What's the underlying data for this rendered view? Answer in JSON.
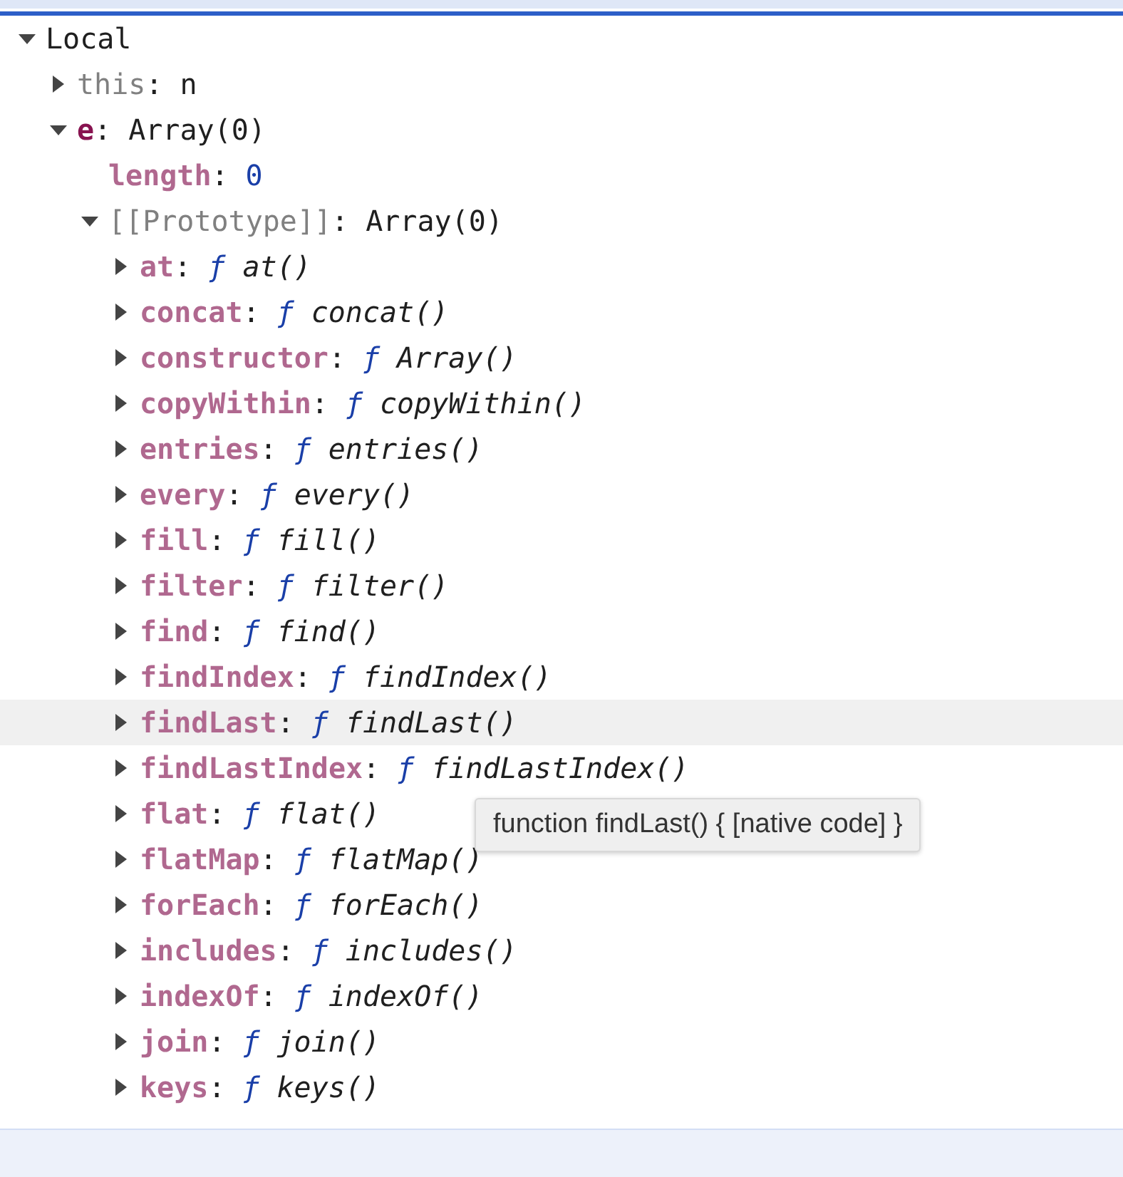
{
  "scope_tree": [
    {
      "name": {
        "text": "Local",
        "kind": "scope"
      },
      "kind": "expandable",
      "expanded": true,
      "selected": false,
      "children": [
        {
          "name": {
            "text": "this",
            "kind": "dim"
          },
          "separator": ":",
          "value": {
            "text": "n",
            "kind": "object"
          },
          "kind": "expandable",
          "expanded": false,
          "selected": false
        },
        {
          "name": {
            "text": "e",
            "kind": "variable"
          },
          "separator": ":",
          "value": {
            "text": "Array(0)",
            "kind": "object"
          },
          "kind": "expandable",
          "expanded": true,
          "selected": false,
          "children": [
            {
              "name": {
                "text": "length",
                "kind": "property"
              },
              "separator": ":",
              "value": {
                "text": "0",
                "kind": "number"
              },
              "kind": "leaf",
              "selected": false
            },
            {
              "name": {
                "text": "[[Prototype]]",
                "kind": "dim"
              },
              "separator": ":",
              "value": {
                "text": "Array(0)",
                "kind": "object"
              },
              "kind": "expandable",
              "expanded": true,
              "selected": false,
              "children": [
                {
                  "name": {
                    "text": "at",
                    "kind": "property"
                  },
                  "separator": ":",
                  "type_mark": "ƒ",
                  "value": {
                    "text": "at()",
                    "kind": "function"
                  },
                  "kind": "expandable",
                  "expanded": false,
                  "selected": false
                },
                {
                  "name": {
                    "text": "concat",
                    "kind": "property"
                  },
                  "separator": ":",
                  "type_mark": "ƒ",
                  "value": {
                    "text": "concat()",
                    "kind": "function"
                  },
                  "kind": "expandable",
                  "expanded": false,
                  "selected": false
                },
                {
                  "name": {
                    "text": "constructor",
                    "kind": "property"
                  },
                  "separator": ":",
                  "type_mark": "ƒ",
                  "value": {
                    "text": "Array()",
                    "kind": "function"
                  },
                  "kind": "expandable",
                  "expanded": false,
                  "selected": false
                },
                {
                  "name": {
                    "text": "copyWithin",
                    "kind": "property"
                  },
                  "separator": ":",
                  "type_mark": "ƒ",
                  "value": {
                    "text": "copyWithin()",
                    "kind": "function"
                  },
                  "kind": "expandable",
                  "expanded": false,
                  "selected": false
                },
                {
                  "name": {
                    "text": "entries",
                    "kind": "property"
                  },
                  "separator": ":",
                  "type_mark": "ƒ",
                  "value": {
                    "text": "entries()",
                    "kind": "function"
                  },
                  "kind": "expandable",
                  "expanded": false,
                  "selected": false
                },
                {
                  "name": {
                    "text": "every",
                    "kind": "property"
                  },
                  "separator": ":",
                  "type_mark": "ƒ",
                  "value": {
                    "text": "every()",
                    "kind": "function"
                  },
                  "kind": "expandable",
                  "expanded": false,
                  "selected": false
                },
                {
                  "name": {
                    "text": "fill",
                    "kind": "property"
                  },
                  "separator": ":",
                  "type_mark": "ƒ",
                  "value": {
                    "text": "fill()",
                    "kind": "function"
                  },
                  "kind": "expandable",
                  "expanded": false,
                  "selected": false
                },
                {
                  "name": {
                    "text": "filter",
                    "kind": "property"
                  },
                  "separator": ":",
                  "type_mark": "ƒ",
                  "value": {
                    "text": "filter()",
                    "kind": "function"
                  },
                  "kind": "expandable",
                  "expanded": false,
                  "selected": false
                },
                {
                  "name": {
                    "text": "find",
                    "kind": "property"
                  },
                  "separator": ":",
                  "type_mark": "ƒ",
                  "value": {
                    "text": "find()",
                    "kind": "function"
                  },
                  "kind": "expandable",
                  "expanded": false,
                  "selected": false
                },
                {
                  "name": {
                    "text": "findIndex",
                    "kind": "property"
                  },
                  "separator": ":",
                  "type_mark": "ƒ",
                  "value": {
                    "text": "findIndex()",
                    "kind": "function"
                  },
                  "kind": "expandable",
                  "expanded": false,
                  "selected": false
                },
                {
                  "name": {
                    "text": "findLast",
                    "kind": "property"
                  },
                  "separator": ":",
                  "type_mark": "ƒ",
                  "value": {
                    "text": "findLast()",
                    "kind": "function"
                  },
                  "kind": "expandable",
                  "expanded": false,
                  "selected": true
                },
                {
                  "name": {
                    "text": "findLastIndex",
                    "kind": "property"
                  },
                  "separator": ":",
                  "type_mark": "ƒ",
                  "value": {
                    "text": "findLastIndex()",
                    "kind": "function"
                  },
                  "kind": "expandable",
                  "expanded": false,
                  "selected": false
                },
                {
                  "name": {
                    "text": "flat",
                    "kind": "property"
                  },
                  "separator": ":",
                  "type_mark": "ƒ",
                  "value": {
                    "text": "flat()",
                    "kind": "function"
                  },
                  "kind": "expandable",
                  "expanded": false,
                  "selected": false
                },
                {
                  "name": {
                    "text": "flatMap",
                    "kind": "property"
                  },
                  "separator": ":",
                  "type_mark": "ƒ",
                  "value": {
                    "text": "flatMap()",
                    "kind": "function"
                  },
                  "kind": "expandable",
                  "expanded": false,
                  "selected": false
                },
                {
                  "name": {
                    "text": "forEach",
                    "kind": "property"
                  },
                  "separator": ":",
                  "type_mark": "ƒ",
                  "value": {
                    "text": "forEach()",
                    "kind": "function"
                  },
                  "kind": "expandable",
                  "expanded": false,
                  "selected": false
                },
                {
                  "name": {
                    "text": "includes",
                    "kind": "property"
                  },
                  "separator": ":",
                  "type_mark": "ƒ",
                  "value": {
                    "text": "includes()",
                    "kind": "function"
                  },
                  "kind": "expandable",
                  "expanded": false,
                  "selected": false
                },
                {
                  "name": {
                    "text": "indexOf",
                    "kind": "property"
                  },
                  "separator": ":",
                  "type_mark": "ƒ",
                  "value": {
                    "text": "indexOf()",
                    "kind": "function"
                  },
                  "kind": "expandable",
                  "expanded": false,
                  "selected": false
                },
                {
                  "name": {
                    "text": "join",
                    "kind": "property"
                  },
                  "separator": ":",
                  "type_mark": "ƒ",
                  "value": {
                    "text": "join()",
                    "kind": "function"
                  },
                  "kind": "expandable",
                  "expanded": false,
                  "selected": false
                },
                {
                  "name": {
                    "text": "keys",
                    "kind": "property"
                  },
                  "separator": ":",
                  "type_mark": "ƒ",
                  "value": {
                    "text": "keys()",
                    "kind": "function"
                  },
                  "kind": "expandable",
                  "expanded": false,
                  "selected": false
                }
              ]
            }
          ]
        }
      ]
    }
  ],
  "tooltip": {
    "text": "function findLast() { [native code] }"
  }
}
